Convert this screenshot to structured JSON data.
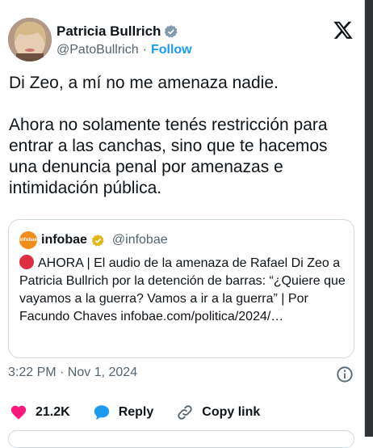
{
  "author": {
    "name": "Patricia Bullrich",
    "handle": "@PatoBullrich",
    "separator": "·",
    "follow_label": "Follow"
  },
  "tweet": {
    "text": "Di Zeo, a mí no me amenaza nadie.\n\nAhora no solamente tenés restricción para entrar a las canchas, sino que te hacemos una denuncia penal por amenazas e intimidación pública."
  },
  "quote": {
    "avatar_text": "infobae",
    "name": "infobae",
    "handle": "@infobae",
    "text": "AHORA | El audio de la amenaza de Rafael Di Zeo a Patricia Bullrich por la detención de barras: “¿Quiere que vayamos a la guerra? Vamos a ir a la guerra” | Por Facundo Chaves infobae.com/politica/2024/…"
  },
  "meta": {
    "timestamp": "3:22 PM · Nov 1, 2024"
  },
  "actions": {
    "likes": "21.2K",
    "reply_label": "Reply",
    "copy_link_label": "Copy link"
  },
  "colors": {
    "accent": "#1d9bf0",
    "like": "#f91880",
    "verified_gray": "#829aab",
    "verified_gold": "#e2b719"
  }
}
